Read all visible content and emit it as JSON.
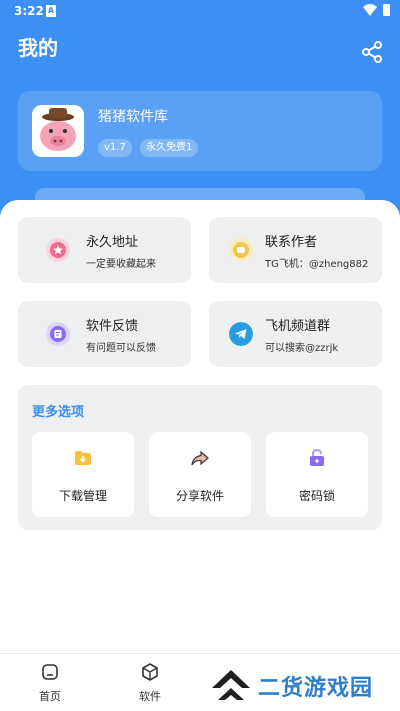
{
  "status_bar": {
    "time": "3:22",
    "notification_icon": "a-icon"
  },
  "header": {
    "title": "我的",
    "share_icon": "share-icon"
  },
  "profile": {
    "app_name": "猪猪软件库",
    "version_tag": "v1.7",
    "license_tag": "永久免费1",
    "logo_icon": "pig-logo"
  },
  "tiles": [
    {
      "title": "永久地址",
      "subtitle": "一定要收藏起来",
      "icon": "star-icon",
      "color": "#f06b8b"
    },
    {
      "title": "联系作者",
      "subtitle": "TG飞机：@zheng882",
      "icon": "chat-icon",
      "color": "#f3c74e"
    },
    {
      "title": "软件反馈",
      "subtitle": "有问题可以反馈",
      "icon": "feedback-icon",
      "color": "#8b6cf0"
    },
    {
      "title": "飞机频道群",
      "subtitle": "可以搜索@zzrjk",
      "icon": "telegram-icon",
      "color": "#2a9de0"
    }
  ],
  "more": {
    "title": "更多选项",
    "options": [
      {
        "label": "下载管理",
        "icon": "folder-download-icon"
      },
      {
        "label": "分享软件",
        "icon": "forward-arrow-icon"
      },
      {
        "label": "密码锁",
        "icon": "lock-icon"
      }
    ]
  },
  "bottom_nav": [
    {
      "label": "首页",
      "icon": "home-icon"
    },
    {
      "label": "软件",
      "icon": "box-icon"
    }
  ],
  "watermark": {
    "text": "二货游戏园"
  },
  "colors": {
    "accent": "#3d8ff3",
    "tile_bg": "#eeeff1"
  }
}
